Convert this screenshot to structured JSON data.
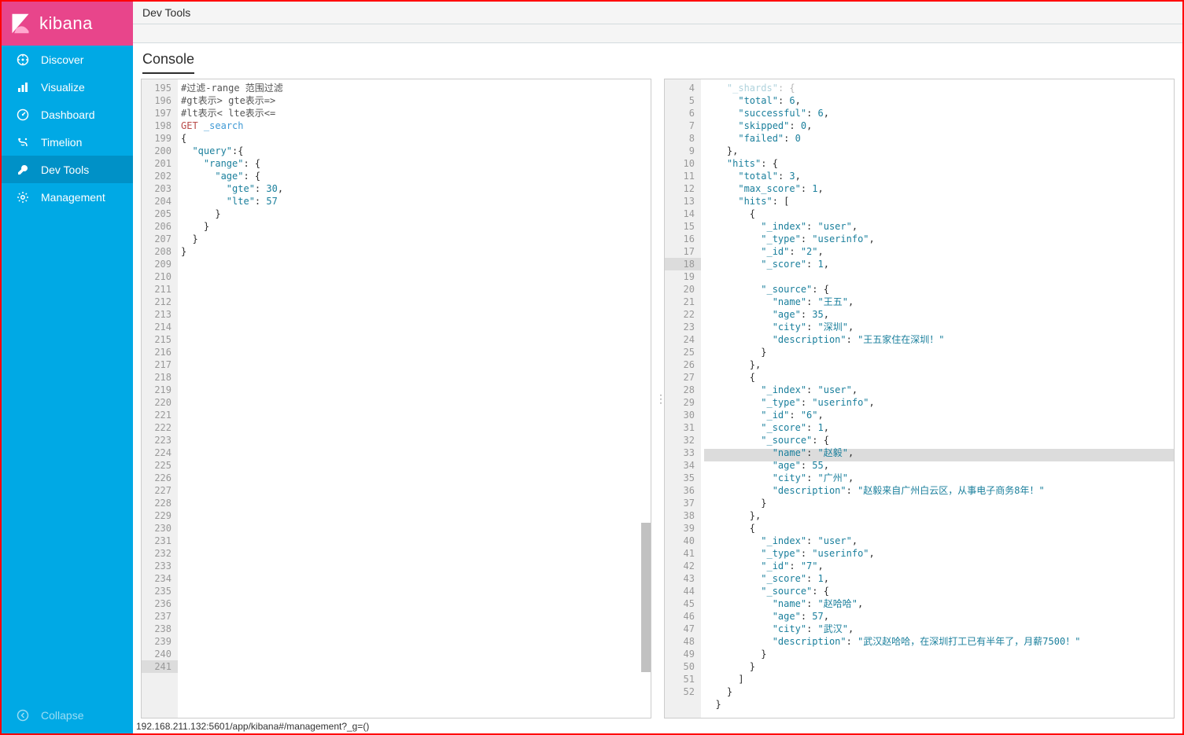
{
  "brand": "kibana",
  "topbar_title": "Dev Tools",
  "tab_label": "Console",
  "nav": [
    {
      "id": "discover",
      "label": "Discover",
      "active": false
    },
    {
      "id": "visualize",
      "label": "Visualize",
      "active": false
    },
    {
      "id": "dashboard",
      "label": "Dashboard",
      "active": false
    },
    {
      "id": "timelion",
      "label": "Timelion",
      "active": false
    },
    {
      "id": "devtools",
      "label": "Dev Tools",
      "active": true
    },
    {
      "id": "management",
      "label": "Management",
      "active": false
    }
  ],
  "collapse_label": "Collapse",
  "status_url": "192.168.211.132:5601/app/kibana#/management?_g=()",
  "request": {
    "first_line": 195,
    "lines": [
      {
        "type": "comment",
        "text": "#过滤-range 范围过滤"
      },
      {
        "type": "comment",
        "text": "#gt表示> gte表示=>"
      },
      {
        "type": "comment",
        "text": "#lt表示< lte表示<="
      },
      {
        "type": "request_line",
        "method": "GET",
        "endpoint": "_search"
      },
      {
        "type": "brace",
        "text": "{",
        "fold": true
      },
      {
        "type": "kv",
        "indent": 1,
        "key": "\"query\"",
        "sep": ":{",
        "fold": true
      },
      {
        "type": "kv",
        "indent": 2,
        "key": "\"range\"",
        "sep": ": {",
        "fold": true
      },
      {
        "type": "kv",
        "indent": 3,
        "key": "\"age\"",
        "sep": ": {",
        "fold": true
      },
      {
        "type": "kv",
        "indent": 4,
        "key": "\"gte\"",
        "sep": ": ",
        "val": "30",
        "comma": ","
      },
      {
        "type": "kv",
        "indent": 4,
        "key": "\"lte\"",
        "sep": ": ",
        "val": "57"
      },
      {
        "type": "brace",
        "indent": 3,
        "text": "}",
        "fold_up": true
      },
      {
        "type": "brace",
        "indent": 2,
        "text": "}",
        "fold_up": true
      },
      {
        "type": "brace",
        "indent": 1,
        "text": "}",
        "fold_up": true
      },
      {
        "type": "brace",
        "indent": 0,
        "text": "}",
        "fold_up": true
      }
    ],
    "empty_rows_until": 241
  },
  "response": {
    "first_line": 4,
    "highlight_line_number": 18,
    "lines": [
      {
        "n": 4,
        "html": "    <span class='key'>\"_shards\"</span>: {",
        "fold": true,
        "faded": true
      },
      {
        "n": 5,
        "html": "      <span class='key'>\"total\"</span>: <span class='num'>6</span>,"
      },
      {
        "n": 6,
        "html": "      <span class='key'>\"successful\"</span>: <span class='num'>6</span>,"
      },
      {
        "n": 7,
        "html": "      <span class='key'>\"skipped\"</span>: <span class='num'>0</span>,"
      },
      {
        "n": 8,
        "html": "      <span class='key'>\"failed\"</span>: <span class='num'>0</span>"
      },
      {
        "n": 9,
        "html": "    },",
        "fold_up": true
      },
      {
        "n": 10,
        "html": "    <span class='key'>\"hits\"</span>: {",
        "fold": true
      },
      {
        "n": 11,
        "html": "      <span class='key'>\"total\"</span>: <span class='num'>3</span>,"
      },
      {
        "n": 12,
        "html": "      <span class='key'>\"max_score\"</span>: <span class='num'>1</span>,"
      },
      {
        "n": 13,
        "html": "      <span class='key'>\"hits\"</span>: [",
        "fold": true
      },
      {
        "n": 14,
        "html": "        {",
        "fold": true
      },
      {
        "n": 15,
        "html": "          <span class='key'>\"_index\"</span>: <span class='str'>\"user\"</span>,"
      },
      {
        "n": 16,
        "html": "          <span class='key'>\"_type\"</span>: <span class='str'>\"userinfo\"</span>,"
      },
      {
        "n": 17,
        "html": "          <span class='key'>\"_id\"</span>: <span class='str'>\"2\"</span>,"
      },
      {
        "n": 18,
        "html": "          <span class='key'>\"_score\"</span>: <span class='num'>1</span>,"
      },
      {
        "n": 19,
        "html": "          <span class='key'>\"_source\"</span>: {",
        "fold": true
      },
      {
        "n": 20,
        "html": "            <span class='key'>\"name\"</span>: <span class='str'>\"王五\"</span>,"
      },
      {
        "n": 21,
        "html": "            <span class='key'>\"age\"</span>: <span class='num'>35</span>,"
      },
      {
        "n": 22,
        "html": "            <span class='key'>\"city\"</span>: <span class='str'>\"深圳\"</span>,"
      },
      {
        "n": 23,
        "html": "            <span class='key'>\"description\"</span>: <span class='str'>\"王五家住在深圳！\"</span>"
      },
      {
        "n": 24,
        "html": "          }",
        "fold_up": true
      },
      {
        "n": 25,
        "html": "        },",
        "fold_up": true
      },
      {
        "n": 26,
        "html": "        {",
        "fold": true
      },
      {
        "n": 27,
        "html": "          <span class='key'>\"_index\"</span>: <span class='str'>\"user\"</span>,"
      },
      {
        "n": 28,
        "html": "          <span class='key'>\"_type\"</span>: <span class='str'>\"userinfo\"</span>,"
      },
      {
        "n": 29,
        "html": "          <span class='key'>\"_id\"</span>: <span class='str'>\"6\"</span>,"
      },
      {
        "n": 30,
        "html": "          <span class='key'>\"_score\"</span>: <span class='num'>1</span>,"
      },
      {
        "n": 31,
        "html": "          <span class='key'>\"_source\"</span>: {",
        "fold": true
      },
      {
        "n": 32,
        "html": "            <span class='key'>\"name\"</span>: <span class='str'>\"赵毅\"</span>,"
      },
      {
        "n": 33,
        "html": "            <span class='key'>\"age\"</span>: <span class='num'>55</span>,"
      },
      {
        "n": 34,
        "html": "            <span class='key'>\"city\"</span>: <span class='str'>\"广州\"</span>,"
      },
      {
        "n": 35,
        "html": "            <span class='key'>\"description\"</span>: <span class='str'>\"赵毅来自广州白云区，从事电子商务8年！\"</span>"
      },
      {
        "n": 36,
        "html": "          }",
        "fold_up": true
      },
      {
        "n": 37,
        "html": "        },",
        "fold_up": true
      },
      {
        "n": 38,
        "html": "        {",
        "fold": true
      },
      {
        "n": 39,
        "html": "          <span class='key'>\"_index\"</span>: <span class='str'>\"user\"</span>,"
      },
      {
        "n": 40,
        "html": "          <span class='key'>\"_type\"</span>: <span class='str'>\"userinfo\"</span>,"
      },
      {
        "n": 41,
        "html": "          <span class='key'>\"_id\"</span>: <span class='str'>\"7\"</span>,"
      },
      {
        "n": 42,
        "html": "          <span class='key'>\"_score\"</span>: <span class='num'>1</span>,"
      },
      {
        "n": 43,
        "html": "          <span class='key'>\"_source\"</span>: {",
        "fold": true
      },
      {
        "n": 44,
        "html": "            <span class='key'>\"name\"</span>: <span class='str'>\"赵哈哈\"</span>,"
      },
      {
        "n": 45,
        "html": "            <span class='key'>\"age\"</span>: <span class='num'>57</span>,"
      },
      {
        "n": 46,
        "html": "            <span class='key'>\"city\"</span>: <span class='str'>\"武汉\"</span>,"
      },
      {
        "n": 47,
        "html": "            <span class='key'>\"description\"</span>: <span class='str'>\"武汉赵哈哈，在深圳打工已有半年了，月薪7500！\"</span>"
      },
      {
        "n": 48,
        "html": "          }",
        "fold_up": true
      },
      {
        "n": 49,
        "html": "        }",
        "fold_up": true
      },
      {
        "n": 50,
        "html": "      ]",
        "fold_up": true
      },
      {
        "n": 51,
        "html": "    }",
        "fold_up": true
      },
      {
        "n": 52,
        "html": "  }",
        "fold_up": true
      }
    ]
  }
}
